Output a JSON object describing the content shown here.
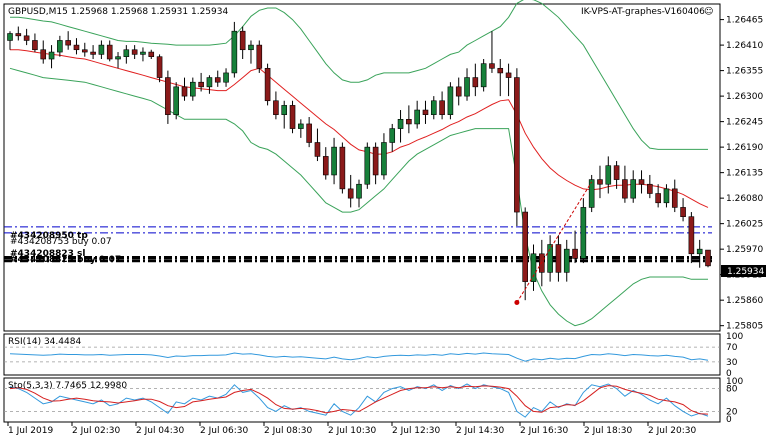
{
  "header": {
    "symbol_line": "GBPUSD,M15  1.25968 1.25968 1.25931 1.25934",
    "expert": "IK-VPS-AT-graphes-V160406",
    "smiley": "☺"
  },
  "colors": {
    "bull": "#17803a",
    "bear": "#8b1a1a",
    "ma": "#e02020",
    "bands": "#3aa35a",
    "rsi": "#3399dd",
    "stoch_main": "#3399dd",
    "stoch_signal": "#d62020",
    "order_line": "#0000cc",
    "level_line": "#000000",
    "trend_arrow": "#cc0000"
  },
  "chart_data": [
    {
      "type": "candlestick",
      "title": "GBPUSD,M15",
      "ohlc_readout": {
        "open": 1.25968,
        "high": 1.25968,
        "low": 1.25931,
        "close": 1.25934
      },
      "y_ticks": [
        "1.26465",
        "1.26410",
        "1.26355",
        "1.26300",
        "1.26245",
        "1.26190",
        "1.26135",
        "1.26080",
        "1.26025",
        "1.25970",
        "1.25915",
        "1.25860",
        "1.25805"
      ],
      "ylim": [
        1.258,
        1.2649
      ],
      "current_price": "1.25934",
      "x_ticks": [
        "1 Jul 2019",
        "2 Jul 02:30",
        "2 Jul 04:30",
        "2 Jul 06:30",
        "2 Jul 08:30",
        "2 Jul 10:30",
        "2 Jul 12:30",
        "2 Jul 14:30",
        "2 Jul 16:30",
        "2 Jul 18:30",
        "2 Jul 20:30"
      ],
      "order_lines": [
        {
          "label": "#434208950 tp",
          "price": 1.26018,
          "style": "dash-dot",
          "color": "blue"
        },
        {
          "label": "#434208753 buy 0.07",
          "price": 1.26005,
          "style": "dash-dot",
          "color": "blue"
        },
        {
          "label": "#434208823 sl",
          "price": 1.25952,
          "style": "dash-dot",
          "color": "black"
        },
        {
          "label": "#434208823 buy 0.07",
          "price": 1.25945,
          "style": "dash-dot",
          "color": "black"
        }
      ],
      "candles": [
        [
          1.2642,
          1.2644,
          1.264,
          1.26435
        ],
        [
          1.26435,
          1.2645,
          1.2642,
          1.2643
        ],
        [
          1.2643,
          1.26445,
          1.2641,
          1.2642
        ],
        [
          1.2642,
          1.26435,
          1.26395,
          1.264
        ],
        [
          1.264,
          1.2642,
          1.2637,
          1.2638
        ],
        [
          1.2638,
          1.2641,
          1.2636,
          1.26395
        ],
        [
          1.26395,
          1.2643,
          1.26385,
          1.2642
        ],
        [
          1.2642,
          1.2644,
          1.264,
          1.2641
        ],
        [
          1.2641,
          1.26425,
          1.2639,
          1.264
        ],
        [
          1.264,
          1.26415,
          1.26385,
          1.26395
        ],
        [
          1.26395,
          1.2641,
          1.2638,
          1.2639
        ],
        [
          1.2639,
          1.2642,
          1.2638,
          1.2641
        ],
        [
          1.2641,
          1.2642,
          1.26375,
          1.2638
        ],
        [
          1.2638,
          1.26395,
          1.2636,
          1.26385
        ],
        [
          1.26385,
          1.2641,
          1.2637,
          1.264
        ],
        [
          1.264,
          1.2641,
          1.2638,
          1.2639
        ],
        [
          1.2639,
          1.26405,
          1.26375,
          1.26395
        ],
        [
          1.26395,
          1.264,
          1.2638,
          1.26385
        ],
        [
          1.26385,
          1.2639,
          1.2633,
          1.2634
        ],
        [
          1.2634,
          1.26355,
          1.2624,
          1.2626
        ],
        [
          1.2626,
          1.2633,
          1.2625,
          1.2632
        ],
        [
          1.2632,
          1.2634,
          1.2629,
          1.263
        ],
        [
          1.263,
          1.2634,
          1.2629,
          1.2633
        ],
        [
          1.2633,
          1.2635,
          1.2631,
          1.2632
        ],
        [
          1.2632,
          1.26345,
          1.26305,
          1.2634
        ],
        [
          1.2634,
          1.26355,
          1.2632,
          1.2633
        ],
        [
          1.2633,
          1.2636,
          1.2632,
          1.2635
        ],
        [
          1.2635,
          1.2646,
          1.2634,
          1.2644
        ],
        [
          1.2644,
          1.2645,
          1.2638,
          1.264
        ],
        [
          1.264,
          1.2642,
          1.2637,
          1.2641
        ],
        [
          1.2641,
          1.2642,
          1.2635,
          1.2636
        ],
        [
          1.2636,
          1.2637,
          1.2628,
          1.2629
        ],
        [
          1.2629,
          1.2631,
          1.2625,
          1.2626
        ],
        [
          1.2626,
          1.2629,
          1.2623,
          1.2628
        ],
        [
          1.2628,
          1.2629,
          1.2622,
          1.2623
        ],
        [
          1.2623,
          1.2625,
          1.2621,
          1.2624
        ],
        [
          1.2624,
          1.26255,
          1.2619,
          1.262
        ],
        [
          1.262,
          1.2623,
          1.2616,
          1.2617
        ],
        [
          1.2617,
          1.2619,
          1.2612,
          1.2613
        ],
        [
          1.2613,
          1.2621,
          1.2611,
          1.2619
        ],
        [
          1.2619,
          1.262,
          1.2609,
          1.261
        ],
        [
          1.261,
          1.2613,
          1.2606,
          1.2608
        ],
        [
          1.2608,
          1.2612,
          1.2606,
          1.2611
        ],
        [
          1.2611,
          1.262,
          1.261,
          1.2619
        ],
        [
          1.2619,
          1.262,
          1.2611,
          1.2613
        ],
        [
          1.2613,
          1.2622,
          1.2612,
          1.262
        ],
        [
          1.262,
          1.2624,
          1.2618,
          1.2623
        ],
        [
          1.2623,
          1.2627,
          1.262,
          1.2625
        ],
        [
          1.2625,
          1.2628,
          1.2622,
          1.2624
        ],
        [
          1.2624,
          1.2629,
          1.2623,
          1.2627
        ],
        [
          1.2627,
          1.2629,
          1.2624,
          1.2626
        ],
        [
          1.2626,
          1.263,
          1.2625,
          1.2629
        ],
        [
          1.2629,
          1.2631,
          1.2625,
          1.2626
        ],
        [
          1.2626,
          1.2633,
          1.2625,
          1.2632
        ],
        [
          1.2632,
          1.2634,
          1.2628,
          1.263
        ],
        [
          1.263,
          1.2636,
          1.2629,
          1.2634
        ],
        [
          1.2634,
          1.2637,
          1.263,
          1.2632
        ],
        [
          1.2632,
          1.2638,
          1.2631,
          1.2637
        ],
        [
          1.2637,
          1.2644,
          1.2635,
          1.2636
        ],
        [
          1.2636,
          1.2638,
          1.263,
          1.2635
        ],
        [
          1.2635,
          1.2637,
          1.263,
          1.2634
        ],
        [
          1.2634,
          1.2636,
          1.2602,
          1.2605
        ],
        [
          1.2605,
          1.2606,
          1.2586,
          1.259
        ],
        [
          1.259,
          1.2598,
          1.2588,
          1.2596
        ],
        [
          1.2596,
          1.2599,
          1.2589,
          1.2592
        ],
        [
          1.2592,
          1.26,
          1.259,
          1.2598
        ],
        [
          1.2598,
          1.26,
          1.259,
          1.2592
        ],
        [
          1.2592,
          1.2599,
          1.259,
          1.2597
        ],
        [
          1.2597,
          1.2601,
          1.2594,
          1.2595
        ],
        [
          1.2595,
          1.2608,
          1.2594,
          1.2606
        ],
        [
          1.2606,
          1.2613,
          1.2605,
          1.2612
        ],
        [
          1.2612,
          1.2615,
          1.2608,
          1.2611
        ],
        [
          1.2611,
          1.2617,
          1.2609,
          1.2615
        ],
        [
          1.2615,
          1.2616,
          1.261,
          1.2612
        ],
        [
          1.2612,
          1.2615,
          1.2607,
          1.2608
        ],
        [
          1.2608,
          1.2614,
          1.2607,
          1.2612
        ],
        [
          1.2612,
          1.2614,
          1.2609,
          1.2611
        ],
        [
          1.2611,
          1.2613,
          1.2608,
          1.2609
        ],
        [
          1.2609,
          1.2611,
          1.2606,
          1.2607
        ],
        [
          1.2607,
          1.2611,
          1.2606,
          1.261
        ],
        [
          1.261,
          1.2612,
          1.2605,
          1.2606
        ],
        [
          1.2606,
          1.2608,
          1.2603,
          1.2604
        ],
        [
          1.2604,
          1.2605,
          1.2594,
          1.2596
        ],
        [
          1.2596,
          1.2599,
          1.2593,
          1.2597
        ],
        [
          1.25968,
          1.25968,
          1.25931,
          1.25934
        ]
      ],
      "ma_line": [
        1.264,
        1.264,
        1.26398,
        1.26395,
        1.26392,
        1.2639,
        1.26388,
        1.26385,
        1.26382,
        1.2638,
        1.26375,
        1.2637,
        1.26365,
        1.2636,
        1.26355,
        1.2635,
        1.26345,
        1.2634,
        1.26335,
        1.2633,
        1.26325,
        1.2632,
        1.26318,
        1.26316,
        1.26314,
        1.26312,
        1.26312,
        1.26325,
        1.2634,
        1.26355,
        1.2636,
        1.26345,
        1.2633,
        1.26315,
        1.263,
        1.26285,
        1.2627,
        1.26255,
        1.2624,
        1.26228,
        1.26212,
        1.26196,
        1.26184,
        1.2618,
        1.26175,
        1.26175,
        1.2618,
        1.2619,
        1.26196,
        1.26205,
        1.26212,
        1.2622,
        1.26228,
        1.26238,
        1.26245,
        1.26255,
        1.26262,
        1.26272,
        1.26282,
        1.2629,
        1.26292,
        1.2626,
        1.2622,
        1.2619,
        1.26165,
        1.26145,
        1.2613,
        1.26118,
        1.26108,
        1.261,
        1.26098,
        1.261,
        1.26105,
        1.26108,
        1.26108,
        1.2611,
        1.2611,
        1.26108,
        1.26105,
        1.261,
        1.26095,
        1.26088,
        1.26078,
        1.26068,
        1.2606
      ],
      "bb_upper": [
        1.2647,
        1.2647,
        1.26468,
        1.26465,
        1.26462,
        1.2646,
        1.26455,
        1.2645,
        1.26445,
        1.2644,
        1.26435,
        1.2643,
        1.26425,
        1.2642,
        1.26418,
        1.26418,
        1.26416,
        1.26414,
        1.26413,
        1.26412,
        1.2641,
        1.2641,
        1.2641,
        1.2641,
        1.2641,
        1.26412,
        1.26414,
        1.2643,
        1.2645,
        1.26472,
        1.26485,
        1.2649,
        1.2649,
        1.2648,
        1.26465,
        1.26445,
        1.2642,
        1.26395,
        1.2637,
        1.2635,
        1.26335,
        1.2633,
        1.2633,
        1.26335,
        1.26345,
        1.2635,
        1.2635,
        1.2635,
        1.2635,
        1.26355,
        1.2636,
        1.2637,
        1.2638,
        1.2639,
        1.26395,
        1.2641,
        1.2642,
        1.2643,
        1.2644,
        1.2645,
        1.2647,
        1.265,
        1.2651,
        1.26508,
        1.265,
        1.26485,
        1.2647,
        1.2645,
        1.2643,
        1.2641,
        1.2638,
        1.2635,
        1.2632,
        1.2629,
        1.2626,
        1.2623,
        1.26205,
        1.26188,
        1.26185,
        1.26185,
        1.26185,
        1.26185,
        1.26185,
        1.26185,
        1.26185
      ],
      "bb_lower": [
        1.2636,
        1.26355,
        1.2635,
        1.26345,
        1.2634,
        1.26338,
        1.26336,
        1.26334,
        1.26332,
        1.2633,
        1.26325,
        1.2632,
        1.26315,
        1.2631,
        1.26305,
        1.263,
        1.26295,
        1.2629,
        1.2628,
        1.2627,
        1.2626,
        1.2625,
        1.2625,
        1.2625,
        1.2625,
        1.2625,
        1.2625,
        1.2624,
        1.26225,
        1.262,
        1.2619,
        1.26185,
        1.26175,
        1.2616,
        1.26145,
        1.2613,
        1.2611,
        1.2609,
        1.2607,
        1.2606,
        1.2605,
        1.2605,
        1.26055,
        1.2607,
        1.26085,
        1.261,
        1.2612,
        1.2614,
        1.2616,
        1.26175,
        1.26185,
        1.26195,
        1.26205,
        1.26215,
        1.2622,
        1.26225,
        1.2623,
        1.2623,
        1.2623,
        1.2623,
        1.2623,
        1.2612,
        1.26,
        1.2592,
        1.2588,
        1.2585,
        1.2583,
        1.25815,
        1.25805,
        1.2581,
        1.2582,
        1.25835,
        1.2585,
        1.25865,
        1.2588,
        1.25895,
        1.25905,
        1.2591,
        1.2591,
        1.2591,
        1.2591,
        1.2591,
        1.25905,
        1.25905,
        1.25905
      ],
      "trend_arrow": {
        "from_bar": 61,
        "from_price": 1.25855,
        "to_bar": 70,
        "to_price": 1.26115
      }
    },
    {
      "type": "line",
      "title": "RSI(14) 34.4484",
      "ylim": [
        0,
        100
      ],
      "y_ticks": [
        "100",
        "70",
        "30",
        "0"
      ],
      "levels": [
        70,
        30
      ],
      "values": [
        52,
        51,
        50,
        49,
        48,
        49,
        51,
        50,
        50,
        49,
        49,
        50,
        48,
        49,
        50,
        50,
        50,
        49,
        46,
        42,
        46,
        45,
        47,
        47,
        48,
        48,
        49,
        54,
        51,
        52,
        49,
        45,
        43,
        45,
        43,
        44,
        42,
        40,
        38,
        43,
        38,
        36,
        39,
        44,
        41,
        45,
        47,
        48,
        47,
        49,
        48,
        50,
        48,
        52,
        50,
        53,
        51,
        54,
        52,
        51,
        50,
        40,
        32,
        38,
        36,
        40,
        37,
        40,
        39,
        45,
        50,
        49,
        52,
        50,
        47,
        50,
        49,
        47,
        46,
        48,
        45,
        43,
        36,
        38,
        34.4484
      ]
    },
    {
      "type": "line",
      "title": "Sto(5,3,3) 7.7465 12.9980",
      "ylim": [
        0,
        100
      ],
      "y_ticks": [
        "100",
        "80",
        "20",
        "0"
      ],
      "levels": [
        80,
        20
      ],
      "series": [
        {
          "name": "main",
          "values": [
            85,
            80,
            70,
            55,
            40,
            45,
            60,
            55,
            50,
            45,
            40,
            50,
            35,
            40,
            55,
            50,
            55,
            45,
            30,
            15,
            45,
            40,
            55,
            50,
            60,
            55,
            65,
            90,
            70,
            75,
            55,
            30,
            20,
            35,
            25,
            30,
            20,
            15,
            10,
            40,
            20,
            10,
            30,
            60,
            45,
            70,
            80,
            85,
            75,
            85,
            80,
            90,
            75,
            88,
            80,
            92,
            80,
            90,
            85,
            80,
            70,
            20,
            5,
            30,
            20,
            45,
            30,
            40,
            35,
            70,
            90,
            85,
            92,
            80,
            60,
            75,
            65,
            50,
            40,
            55,
            35,
            20,
            8,
            15,
            7.7465
          ]
        },
        {
          "name": "signal",
          "values": [
            80,
            82,
            78,
            68,
            55,
            47,
            48,
            52,
            55,
            52,
            48,
            46,
            45,
            42,
            45,
            48,
            52,
            52,
            46,
            35,
            30,
            33,
            45,
            48,
            52,
            55,
            58,
            70,
            75,
            78,
            68,
            55,
            38,
            28,
            26,
            28,
            26,
            22,
            16,
            20,
            25,
            23,
            20,
            32,
            45,
            55,
            65,
            75,
            80,
            82,
            82,
            85,
            82,
            85,
            82,
            86,
            85,
            87,
            86,
            84,
            80,
            60,
            35,
            20,
            18,
            30,
            32,
            38,
            36,
            48,
            65,
            82,
            88,
            86,
            78,
            72,
            68,
            62,
            52,
            48,
            45,
            38,
            22,
            14,
            12.998
          ]
        }
      ]
    }
  ]
}
